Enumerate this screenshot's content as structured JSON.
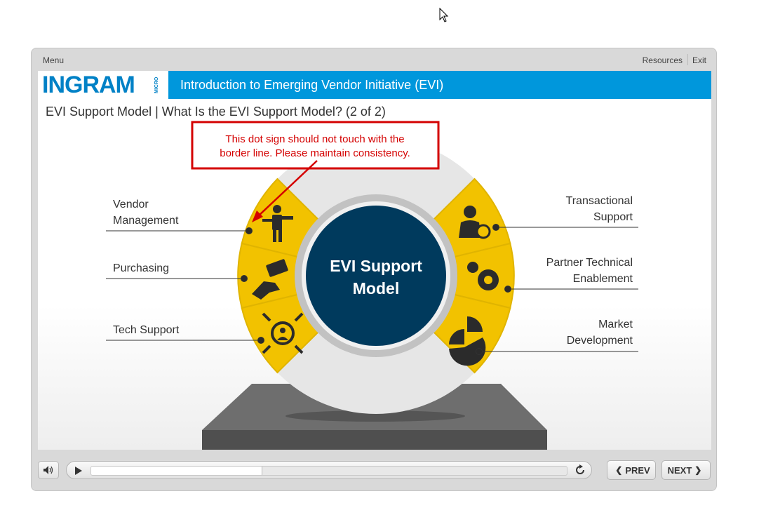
{
  "topbar": {
    "menu": "Menu",
    "resources": "Resources",
    "exit": "Exit"
  },
  "header": {
    "logo": "INGRAM",
    "logo_micro": "MICRO",
    "course_title": "Introduction to Emerging Vendor Initiative (EVI)"
  },
  "slide": {
    "title": "EVI Support Model | What Is the EVI Support Model? (2 of 2)",
    "center_line1": "EVI Support",
    "center_line2": "Model",
    "annotation_line1": "This dot sign should not touch with the",
    "annotation_line2": "border line. Please maintain consistency.",
    "labels": {
      "vendor_1": "Vendor",
      "vendor_2": "Management",
      "purchasing": "Purchasing",
      "tech_support": "Tech Support",
      "transactional_1": "Transactional",
      "transactional_2": "Support",
      "partner_1": "Partner Technical",
      "partner_2": "Enablement",
      "market_1": "Market",
      "market_2": "Development"
    }
  },
  "controls": {
    "prev": "PREV",
    "next": "NEXT",
    "progress": 0.36
  },
  "colors": {
    "banner": "#0097dc",
    "segment": "#f2c200",
    "center": "#003a5d",
    "annotation": "#d40000"
  }
}
